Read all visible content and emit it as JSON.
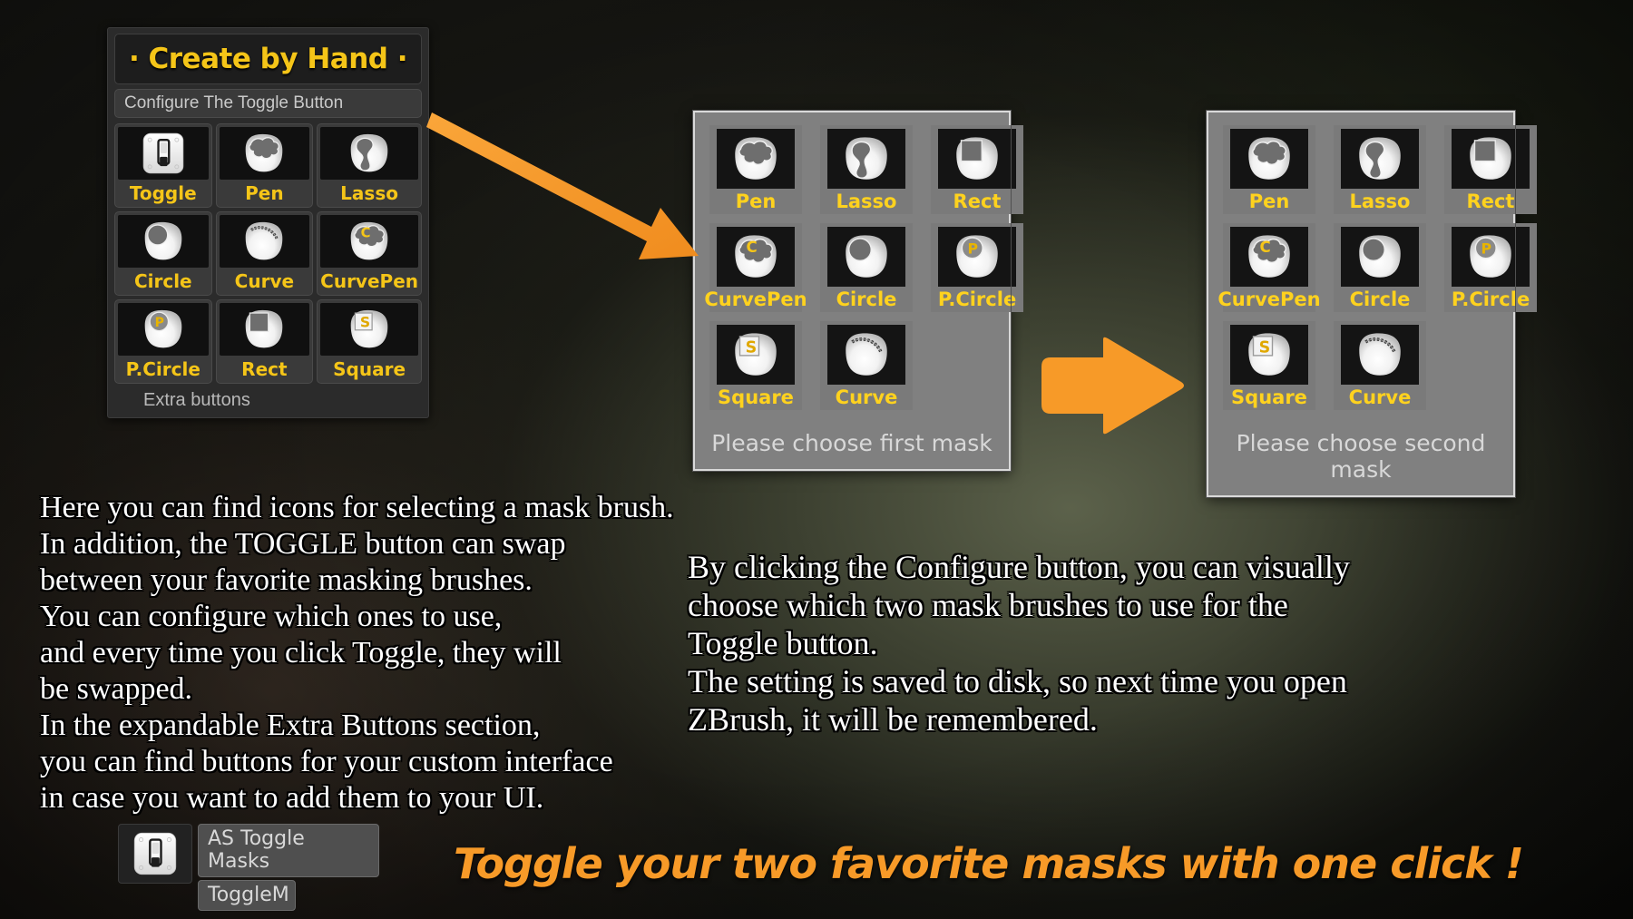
{
  "colors": {
    "accent_yellow": "#f5c518",
    "label_yellow": "#ffd21e",
    "arrow_orange": "#f79a28",
    "panel_dark": "#2b2b2b",
    "chooser_grey": "#808080",
    "body_text": "#ffffff"
  },
  "plugin_panel": {
    "title": "· Create by Hand ·",
    "configure_button": "Configure The Toggle Button",
    "extra_buttons_label": "Extra buttons",
    "buttons": [
      {
        "label": "Toggle",
        "icon": "toggle-switch-icon"
      },
      {
        "label": "Pen",
        "icon": "mask-pen-icon"
      },
      {
        "label": "Lasso",
        "icon": "mask-lasso-icon"
      },
      {
        "label": "Circle",
        "icon": "mask-circle-icon"
      },
      {
        "label": "Curve",
        "icon": "mask-curve-icon"
      },
      {
        "label": "CurvePen",
        "icon": "mask-curvepen-icon"
      },
      {
        "label": "P.Circle",
        "icon": "mask-pcircle-icon"
      },
      {
        "label": "Rect",
        "icon": "mask-rect-icon"
      },
      {
        "label": "Square",
        "icon": "mask-square-icon"
      }
    ]
  },
  "chooser_first": {
    "footer": "Please choose first mask",
    "items": [
      {
        "label": "Pen",
        "icon": "mask-pen-icon"
      },
      {
        "label": "Lasso",
        "icon": "mask-lasso-icon"
      },
      {
        "label": "Rect",
        "icon": "mask-rect-icon"
      },
      {
        "label": "CurvePen",
        "icon": "mask-curvepen-icon"
      },
      {
        "label": "Circle",
        "icon": "mask-circle-icon"
      },
      {
        "label": "P.Circle",
        "icon": "mask-pcircle-icon"
      },
      {
        "label": "Square",
        "icon": "mask-square-icon"
      },
      {
        "label": "Curve",
        "icon": "mask-curve-icon"
      }
    ]
  },
  "chooser_second": {
    "footer": "Please choose second mask",
    "items": [
      {
        "label": "Pen",
        "icon": "mask-pen-icon"
      },
      {
        "label": "Lasso",
        "icon": "mask-lasso-icon"
      },
      {
        "label": "Rect",
        "icon": "mask-rect-icon"
      },
      {
        "label": "CurvePen",
        "icon": "mask-curvepen-icon"
      },
      {
        "label": "Circle",
        "icon": "mask-circle-icon"
      },
      {
        "label": "P.Circle",
        "icon": "mask-pcircle-icon"
      },
      {
        "label": "Square",
        "icon": "mask-square-icon"
      },
      {
        "label": "Curve",
        "icon": "mask-curve-icon"
      }
    ]
  },
  "text_left": [
    "Here you can find icons for selecting a mask brush.",
    "In addition, the TOGGLE button can swap",
    "between your favorite masking brushes.",
    "You can configure which ones to use,",
    "and every time you click Toggle, they will",
    "be swapped.",
    "In the expandable Extra Buttons section,",
    "you can find buttons for your custom interface",
    "in case you want to add them to your UI."
  ],
  "text_right": [
    "By clicking the Configure button, you can visually",
    "choose which two mask brushes to use for the",
    "Toggle button.",
    "The setting is saved to disk, so next time you open",
    "ZBrush, it will be remembered."
  ],
  "bottom_widget": {
    "icon": "toggle-switch-icon",
    "field_primary": "AS Toggle Masks",
    "field_secondary": "ToggleM"
  },
  "tagline": "Toggle your two favorite masks with one click !",
  "arrows": {
    "diagonal": "arrow-diagonal-icon",
    "right": "arrow-right-icon"
  }
}
